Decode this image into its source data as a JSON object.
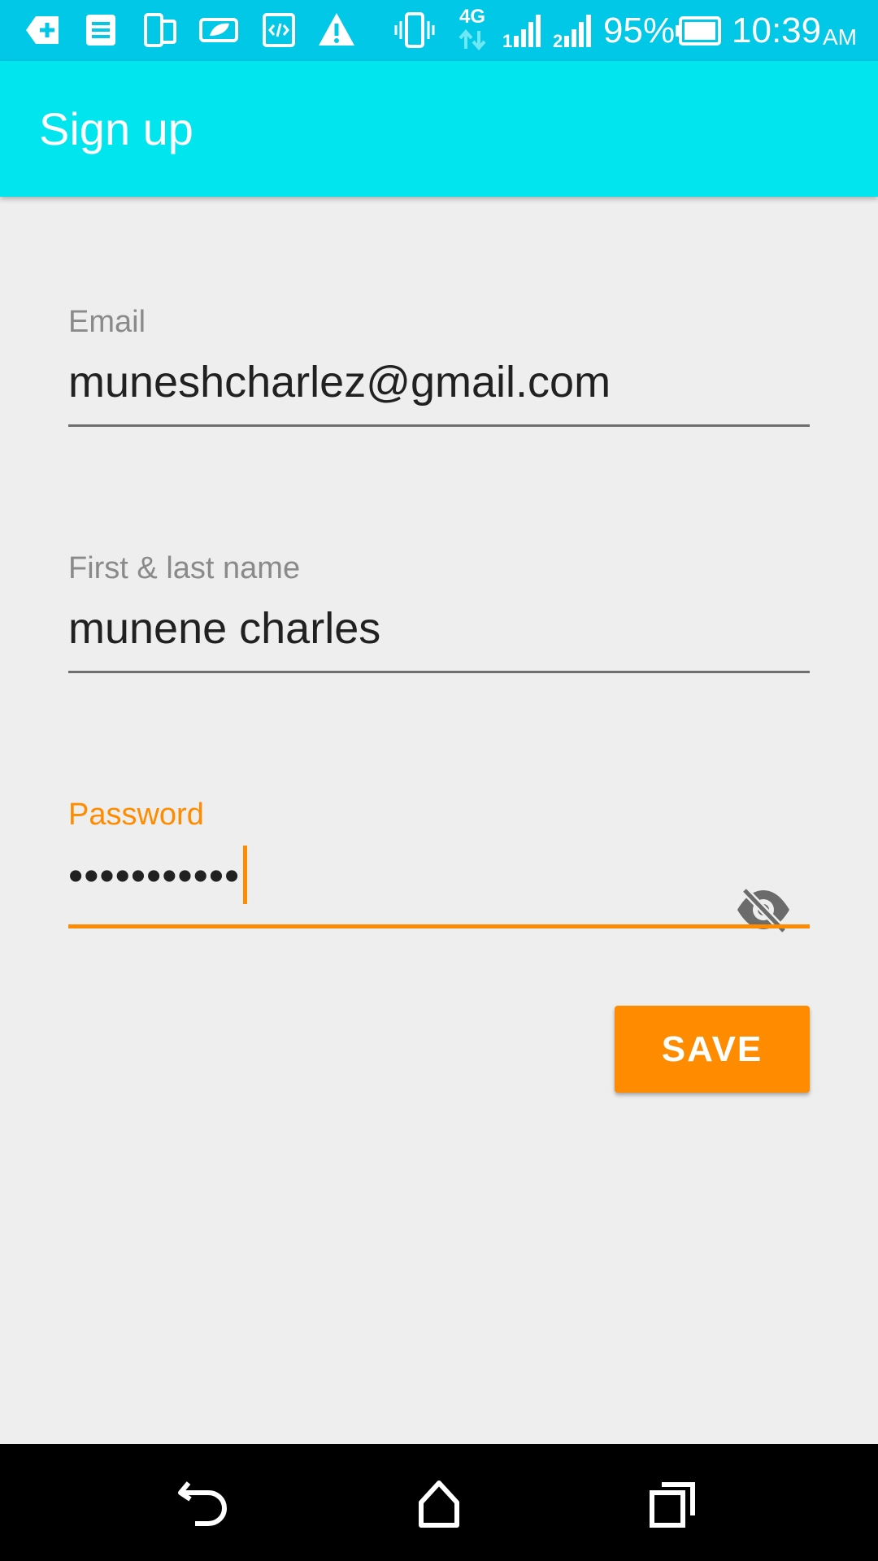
{
  "status_bar": {
    "icons": [
      "add-notification-icon",
      "document-icon",
      "screen-mirror-icon",
      "battery-saver-icon",
      "code-icon",
      "warning-icon",
      "vibrate-icon",
      "network-4g-icon",
      "signal-sim1-icon",
      "signal-sim2-icon",
      "battery-icon"
    ],
    "network_type": "4G",
    "battery_percent": "95%",
    "time": "10:39",
    "ampm": "AM"
  },
  "app_bar": {
    "title": "Sign up",
    "color": "#00e5ee"
  },
  "form": {
    "email": {
      "label": "Email",
      "value": "muneshcharlez@gmail.com"
    },
    "name": {
      "label": "First & last name",
      "value": "munene charles"
    },
    "password": {
      "label": "Password",
      "value_masked": "•••••••••••",
      "toggle_icon": "eye-off-icon"
    },
    "save_label": "SAVE"
  },
  "colors": {
    "status_bar": "#00c8e6",
    "accent": "#ff8c00",
    "background": "#eeeeee"
  },
  "nav_bar": {
    "icons": [
      "back-icon",
      "home-icon",
      "recents-icon"
    ]
  }
}
